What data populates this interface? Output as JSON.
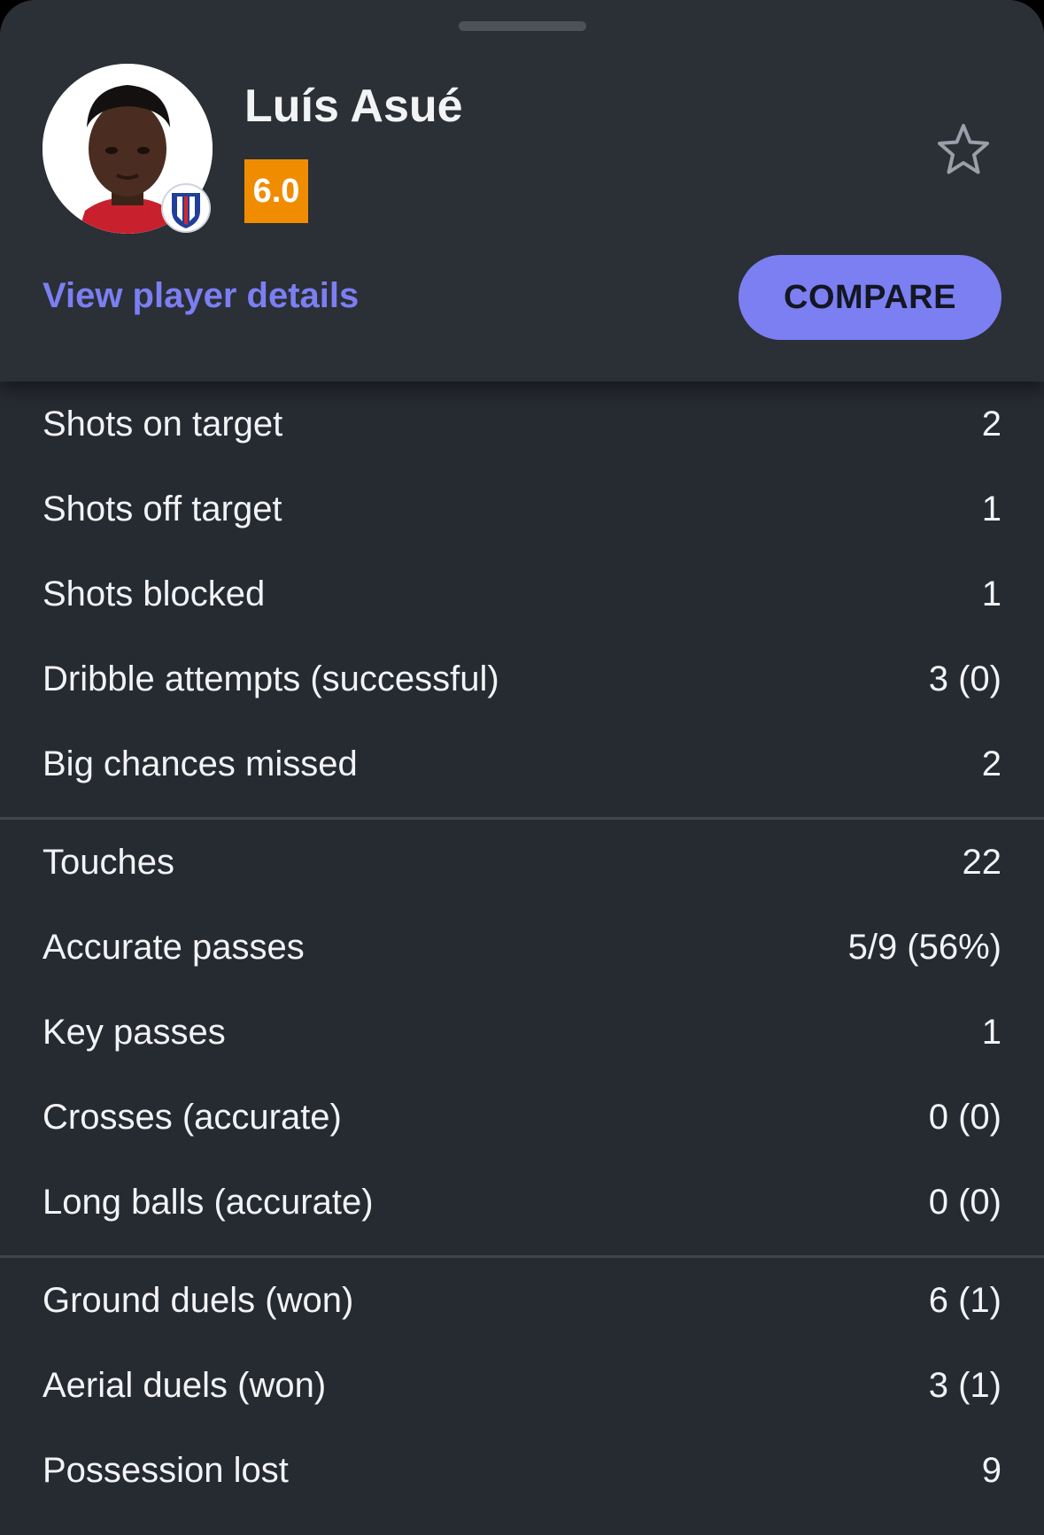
{
  "player": {
    "name": "Luís Asué",
    "rating": "6.0",
    "details_link": "View player details",
    "compare_label": "COMPARE"
  },
  "colors": {
    "accent": "#7b7ff2",
    "rating_bg": "#f08c00",
    "background": "#262a31",
    "header_bg": "#2b2f36"
  },
  "icons": {
    "favorite": "star-outline-icon",
    "club": "club-crest-icon"
  },
  "stat_groups": [
    {
      "rows": [
        {
          "label": "Shots on target",
          "value": "2"
        },
        {
          "label": "Shots off target",
          "value": "1"
        },
        {
          "label": "Shots blocked",
          "value": "1"
        },
        {
          "label": "Dribble attempts (successful)",
          "value": "3 (0)"
        },
        {
          "label": "Big chances missed",
          "value": "2"
        }
      ]
    },
    {
      "rows": [
        {
          "label": "Touches",
          "value": "22"
        },
        {
          "label": "Accurate passes",
          "value": "5/9 (56%)"
        },
        {
          "label": "Key passes",
          "value": "1"
        },
        {
          "label": "Crosses (accurate)",
          "value": "0 (0)"
        },
        {
          "label": "Long balls (accurate)",
          "value": "0 (0)"
        }
      ]
    },
    {
      "rows": [
        {
          "label": "Ground duels (won)",
          "value": "6 (1)"
        },
        {
          "label": "Aerial duels (won)",
          "value": "3 (1)"
        },
        {
          "label": "Possession lost",
          "value": "9"
        }
      ]
    }
  ]
}
